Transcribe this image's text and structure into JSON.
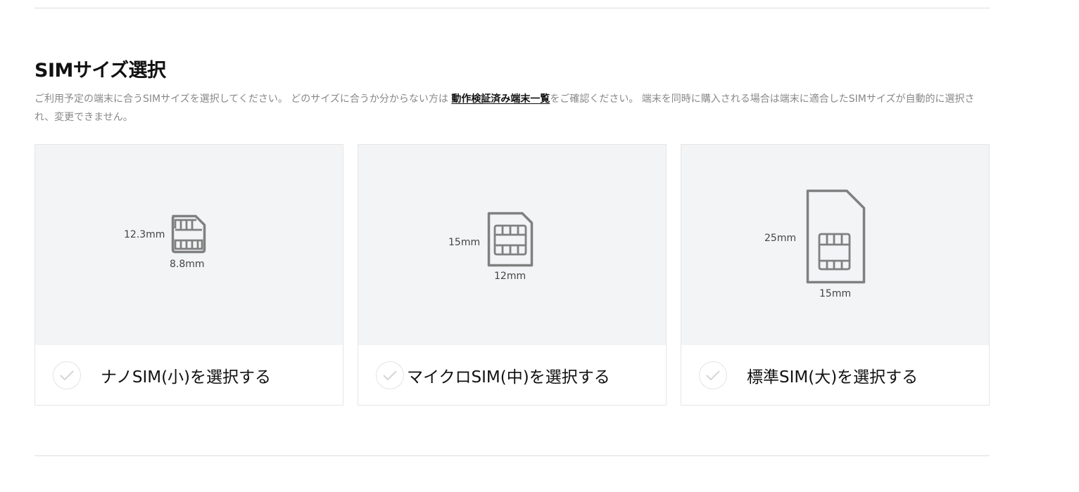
{
  "section": {
    "title": "SIMサイズ選択",
    "description_before": "ご利用予定の端末に合うSIMサイズを選択してください。 どのサイズに合うか分からない方は ",
    "description_link": "動作検証済み端末一覧",
    "description_after": "をご確認ください。 端末を同時に購入される場合は端末に適合したSIMサイズが自動的に選択され、変更できません。"
  },
  "cards": [
    {
      "label": "ナノSIM(小)を選択する",
      "height_dim": "12.3mm",
      "width_dim": "8.8mm",
      "icon": "nano-sim-icon",
      "selected": false
    },
    {
      "label": "マイクロSIM(中)を選択する",
      "height_dim": "15mm",
      "width_dim": "12mm",
      "icon": "micro-sim-icon",
      "selected": false
    },
    {
      "label": "標準SIM(大)を選択する",
      "height_dim": "25mm",
      "width_dim": "15mm",
      "icon": "standard-sim-icon",
      "selected": false
    }
  ],
  "colors": {
    "icon_stroke": "#808080",
    "card_image_bg": "#f3f4f6",
    "check_mark": "#d5d5d5"
  }
}
